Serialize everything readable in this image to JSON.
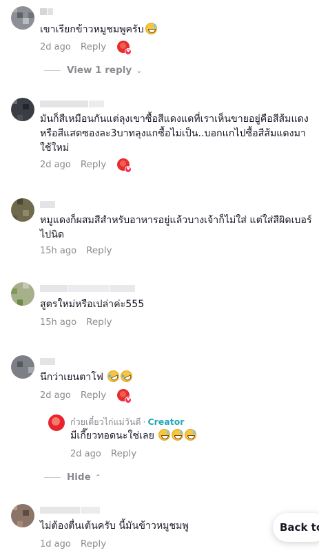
{
  "comments": [
    {
      "text": "เขาเรียกข้าวหมูชมพูครับ",
      "emoji": "sweat-smile",
      "time": "2d ago",
      "reply": "Reply",
      "liked_by_creator": true
    },
    {
      "text": "มันก็สีเหมือนกันแต่ลุงเขาซื้อสีแดงแดที่เราเห็นขายอยู่คือสีส้มแดง หรือสีแสดซองละ3บาทลุงแกซื้อไม่เป็น..บอกแกไปซื้อสีส้มแดงมาใช้ใหม่",
      "time": "2d ago",
      "reply": "Reply",
      "liked_by_creator": true
    },
    {
      "text": "หมูแดงก็ผสมสีสำหรับอาหารอยู่แล้วบางเจ้าก็ไม่ใส่ แต่ใส่สีผิดเบอร์ไปนิด",
      "time": "15h ago",
      "reply": "Reply"
    },
    {
      "text": "สูตรใหม่หรือเปล่าค่ะ555",
      "time": "15h ago",
      "reply": "Reply"
    },
    {
      "text": "นึกว่าเยนตาโฟ",
      "time": "2d ago",
      "reply": "Reply",
      "liked_by_creator": true
    },
    {
      "text": "ไม่ต้องตื่นเต้นครับ  นี้มันข้าวหมูชมพู",
      "time": "1d ago",
      "reply": "Reply"
    }
  ],
  "view_replies": "View 1 reply",
  "hide": "Hide",
  "creator_reply": {
    "author": "ก๋วยเตี๋ยวไก่แม่วันดี",
    "separator": "·",
    "badge": "Creator",
    "text": "มีเกี๊ยวทอดนะใช่เลย",
    "time": "2d ago",
    "reply": "Reply"
  },
  "back_button": "Back to",
  "colors": {
    "meta_gray": "#8a8b91",
    "creator_teal": "#20a8b8",
    "like_red": "#e52d2d",
    "text": "#161823"
  },
  "icons": [
    "sweat-smile-emoji",
    "rofl-emoji",
    "chevron-down-icon",
    "chevron-up-icon",
    "creator-liked-icon"
  ]
}
